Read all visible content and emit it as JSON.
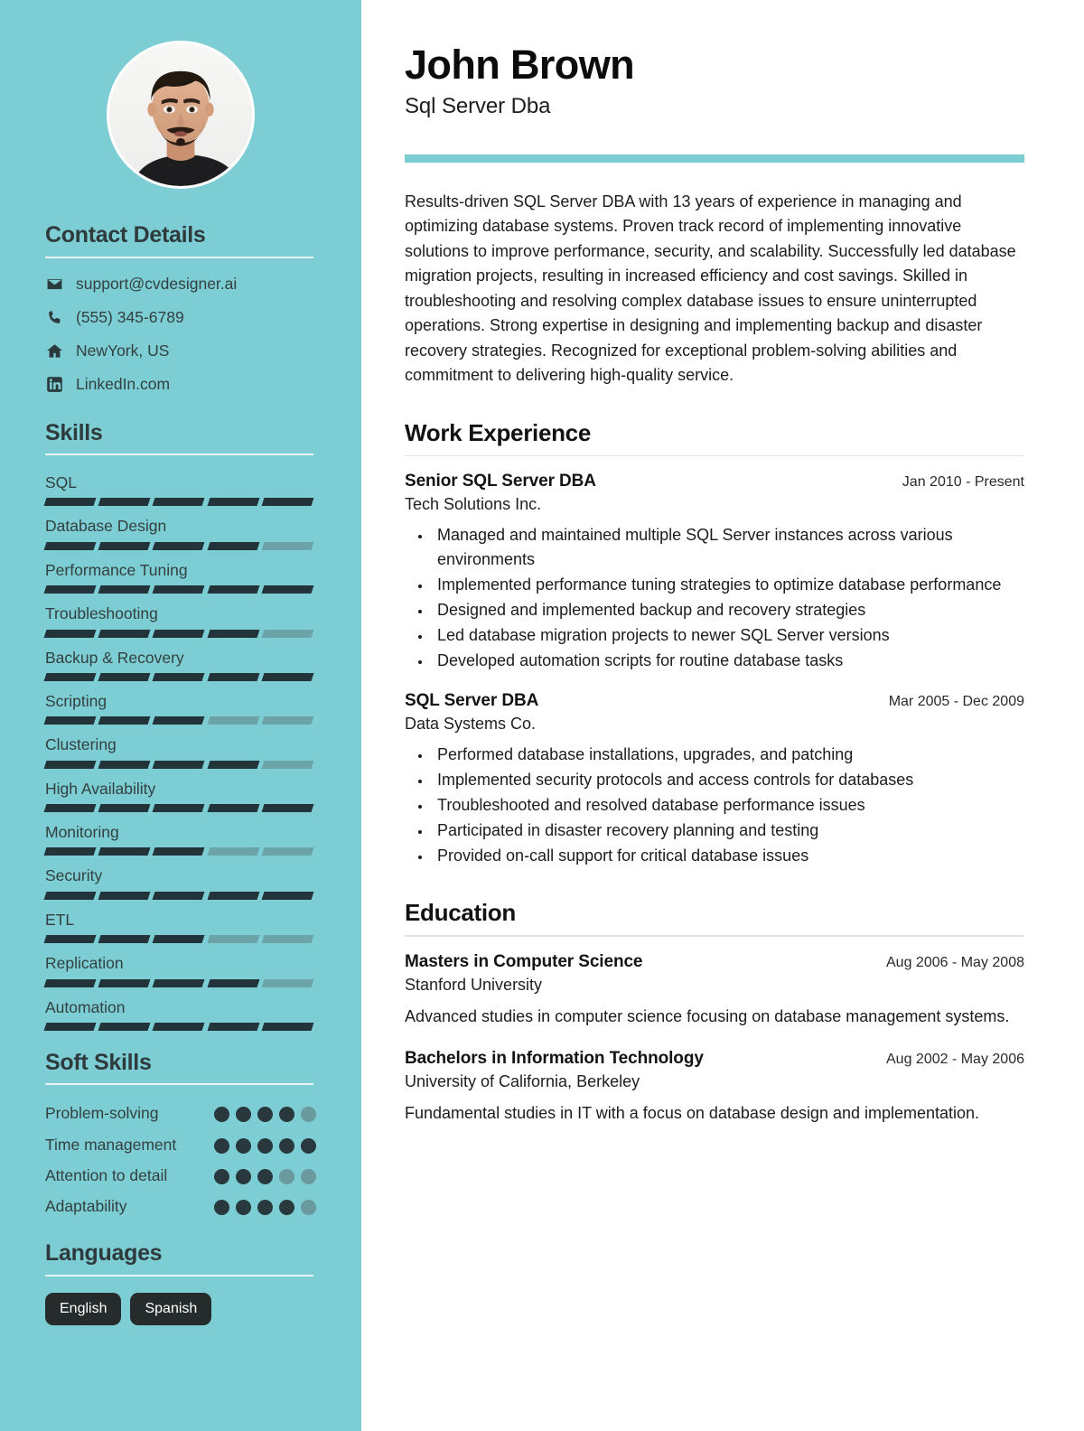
{
  "colors": {
    "sidebar_bg": "#7ccdd4",
    "accent": "#7ccdd4",
    "dark": "#22343a",
    "muted": "#6ba3a8",
    "tag_bg": "#262b2c"
  },
  "header": {
    "name": "John Brown",
    "role": "Sql Server Dba"
  },
  "summary": {
    "text": "Results-driven SQL Server DBA with 13 years of experience in managing and optimizing database systems. Proven track record of implementing innovative solutions to improve performance, security, and scalability. Successfully led database migration projects, resulting in increased efficiency and cost savings. Skilled in troubleshooting and resolving complex database issues to ensure uninterrupted operations. Strong expertise in designing and implementing backup and disaster recovery strategies. Recognized for exceptional problem-solving abilities and commitment to delivering high-quality service."
  },
  "sidebar": {
    "contact": {
      "heading": "Contact Details",
      "items": [
        {
          "icon": "envelope-icon",
          "value": "support@cvdesigner.ai"
        },
        {
          "icon": "phone-icon",
          "value": "(555) 345-6789"
        },
        {
          "icon": "home-icon",
          "value": "NewYork, US"
        },
        {
          "icon": "linkedin-icon",
          "value": "LinkedIn.com"
        }
      ]
    },
    "skills": {
      "heading": "Skills",
      "max": 5,
      "items": [
        {
          "name": "SQL",
          "level": 5
        },
        {
          "name": "Database Design",
          "level": 4
        },
        {
          "name": "Performance Tuning",
          "level": 5
        },
        {
          "name": "Troubleshooting",
          "level": 4
        },
        {
          "name": "Backup & Recovery",
          "level": 5
        },
        {
          "name": "Scripting",
          "level": 3
        },
        {
          "name": "Clustering",
          "level": 4
        },
        {
          "name": "High Availability",
          "level": 5
        },
        {
          "name": "Monitoring",
          "level": 3
        },
        {
          "name": "Security",
          "level": 5
        },
        {
          "name": "ETL",
          "level": 3
        },
        {
          "name": "Replication",
          "level": 4
        },
        {
          "name": "Automation",
          "level": 5
        }
      ]
    },
    "soft_skills": {
      "heading": "Soft Skills",
      "max": 5,
      "items": [
        {
          "name": "Problem-solving",
          "level": 4
        },
        {
          "name": "Time management",
          "level": 5
        },
        {
          "name": "Attention to detail",
          "level": 3
        },
        {
          "name": "Adaptability",
          "level": 4
        }
      ]
    },
    "languages": {
      "heading": "Languages",
      "items": [
        {
          "name": "English"
        },
        {
          "name": "Spanish"
        }
      ]
    }
  },
  "work": {
    "heading": "Work Experience",
    "entries": [
      {
        "title": "Senior SQL Server DBA",
        "date": "Jan 2010 - Present",
        "org": "Tech Solutions Inc.",
        "bullets": [
          "Managed and maintained multiple SQL Server instances across various environments",
          "Implemented performance tuning strategies to optimize database performance",
          "Designed and implemented backup and recovery strategies",
          "Led database migration projects to newer SQL Server versions",
          "Developed automation scripts for routine database tasks"
        ]
      },
      {
        "title": "SQL Server DBA",
        "date": "Mar 2005 - Dec 2009",
        "org": "Data Systems Co.",
        "bullets": [
          "Performed database installations, upgrades, and patching",
          "Implemented security protocols and access controls for databases",
          "Troubleshooted and resolved database performance issues",
          "Participated in disaster recovery planning and testing",
          "Provided on-call support for critical database issues"
        ]
      }
    ]
  },
  "education": {
    "heading": "Education",
    "entries": [
      {
        "title": "Masters in Computer Science",
        "date": "Aug 2006 - May 2008",
        "org": "Stanford University",
        "desc": "Advanced studies in computer science focusing on database management systems."
      },
      {
        "title": "Bachelors in Information Technology",
        "date": "Aug 2002 - May 2006",
        "org": "University of California, Berkeley",
        "desc": "Fundamental studies in IT with a focus on database design and implementation."
      }
    ]
  }
}
